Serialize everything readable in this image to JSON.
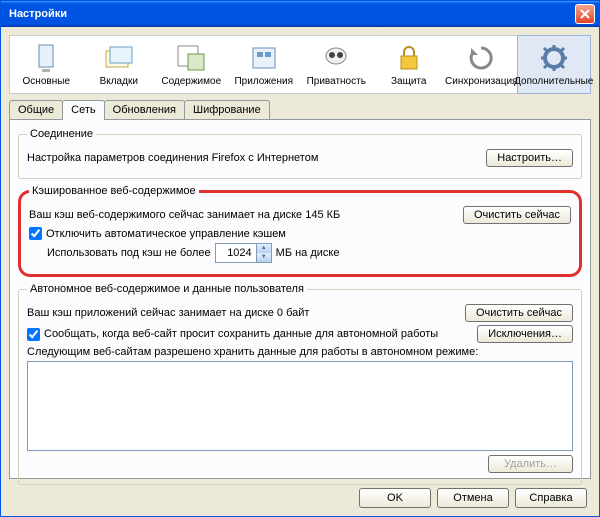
{
  "window": {
    "title": "Настройки"
  },
  "toolbar": {
    "items": [
      {
        "label": "Основные"
      },
      {
        "label": "Вкладки"
      },
      {
        "label": "Содержимое"
      },
      {
        "label": "Приложения"
      },
      {
        "label": "Приватность"
      },
      {
        "label": "Защита"
      },
      {
        "label": "Синхронизация"
      },
      {
        "label": "Дополнительные"
      }
    ]
  },
  "tabs": {
    "items": [
      {
        "label": "Общие"
      },
      {
        "label": "Сеть"
      },
      {
        "label": "Обновления"
      },
      {
        "label": "Шифрование"
      }
    ]
  },
  "connection": {
    "legend": "Соединение",
    "text": "Настройка параметров соединения Firefox с Интернетом",
    "button": "Настроить…"
  },
  "cache": {
    "legend": "Кэшированное веб-содержимое",
    "status": "Ваш кэш веб-содержимого сейчас занимает на диске 145 КБ",
    "clear": "Очистить сейчас",
    "checkbox": "Отключить автоматическое управление кэшем",
    "limit_pre": "Использовать под кэш не более",
    "limit_val": "1024",
    "limit_suf": "МБ на диске"
  },
  "offline": {
    "legend": "Автономное веб-содержимое и данные пользователя",
    "status": "Ваш кэш приложений сейчас занимает на диске 0 байт",
    "clear": "Очистить сейчас",
    "checkbox": "Сообщать, когда веб-сайт просит сохранить данные для автономной работы",
    "exceptions": "Исключения…",
    "list_label": "Следующим веб-сайтам разрешено хранить данные для работы в автономном режиме:",
    "delete": "Удалить…"
  },
  "footer": {
    "ok": "OK",
    "cancel": "Отмена",
    "help": "Справка"
  }
}
